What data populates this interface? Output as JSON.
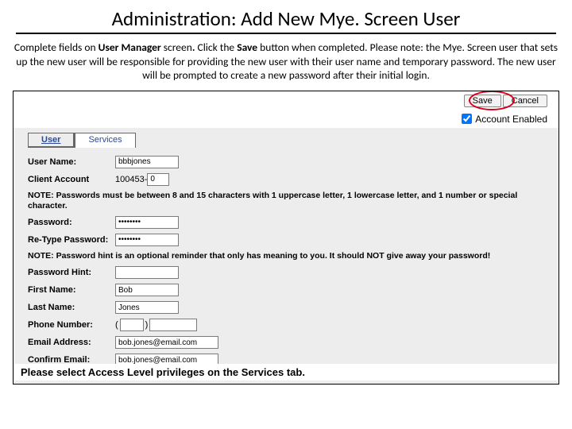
{
  "title": "Administration: Add New Mye. Screen User",
  "instruction_parts": {
    "p1": "Complete fields on ",
    "p2": "User Manager",
    "p3": " screen",
    "p4": ". ",
    "p5": "Click the ",
    "p6": "Save",
    "p7": " button when completed.  Please note: the Mye. Screen user that sets up the new user will be responsible for providing the new user with their user name and temporary password.  The new user will be prompted to create a new password after their initial login."
  },
  "buttons": {
    "save": "Save",
    "cancel": "Cancel"
  },
  "account_enabled_label": "Account Enabled",
  "tabs": {
    "user": "User",
    "services": "Services"
  },
  "fields": {
    "user_name": {
      "label": "User Name:",
      "value": "bbbjones"
    },
    "client_account": {
      "label": "Client Account",
      "prefix": "100453-",
      "suffix": "0"
    },
    "note_password": "NOTE: Passwords must be between 8 and 15 characters with 1 uppercase letter, 1 lowercase letter, and 1 number or special character.",
    "password": {
      "label": "Password:",
      "value": "••••••••"
    },
    "retype_password": {
      "label": "Re-Type Password:",
      "value": "••••••••"
    },
    "note_hint": "NOTE: Password hint is an optional reminder that only has meaning to you. It should NOT give away your password!",
    "password_hint": {
      "label": "Password Hint:",
      "value": ""
    },
    "first_name": {
      "label": "First Name:",
      "value": "Bob"
    },
    "last_name": {
      "label": "Last Name:",
      "value": "Jones"
    },
    "phone": {
      "label": "Phone Number:",
      "area": "",
      "num": ""
    },
    "email": {
      "label": "Email Address:",
      "value": "bob.jones@email.com"
    },
    "confirm_email": {
      "label": "Confirm Email:",
      "value": "bob.jones@email.com"
    }
  },
  "footer": "Please select Access Level privileges on the Services tab."
}
